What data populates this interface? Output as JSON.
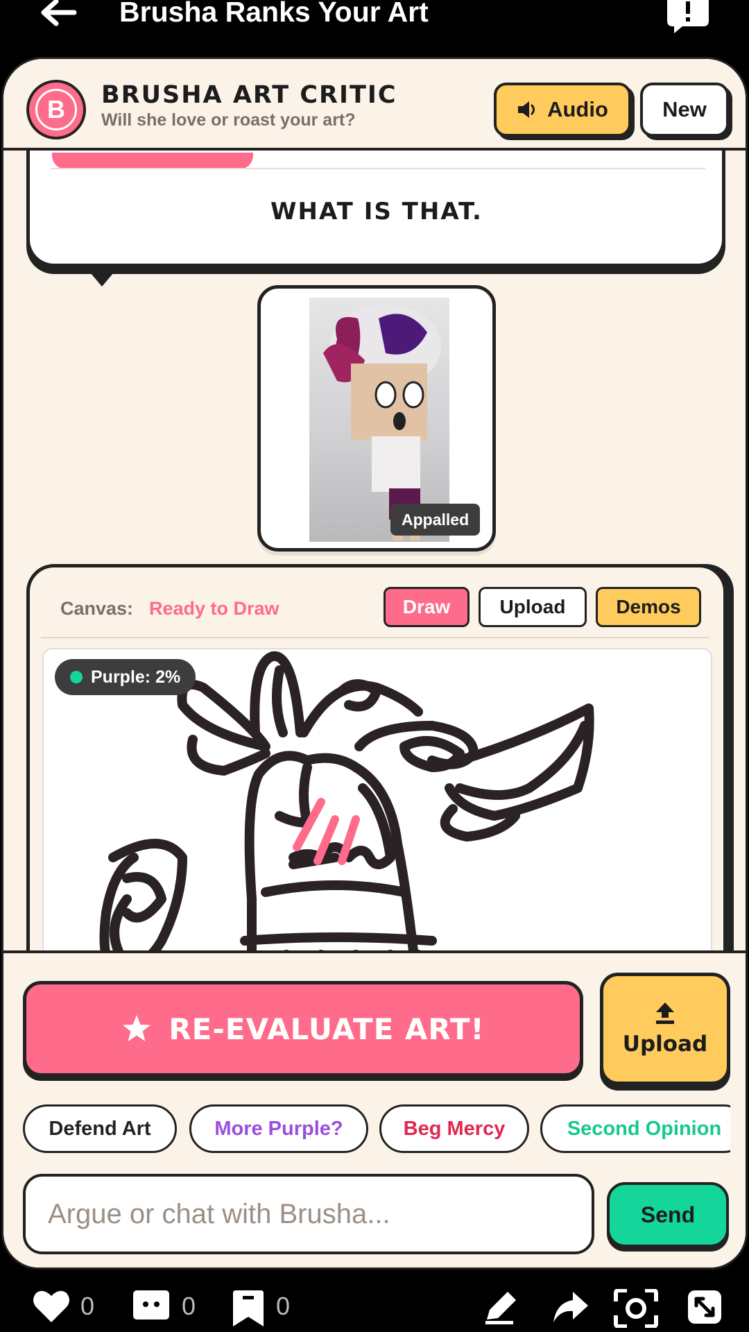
{
  "topbar": {
    "title": "Brusha Ranks Your Art"
  },
  "header": {
    "avatar_letter": "B",
    "title": "BRUSHA ART CRITIC",
    "subtitle": "Will she love or roast your art?",
    "audio_label": "Audio",
    "new_label": "New"
  },
  "bubble": {
    "text": "WHAT IS THAT."
  },
  "preview": {
    "reaction_badge": "Appalled"
  },
  "canvas": {
    "label": "Canvas:",
    "status": "Ready to Draw",
    "tabs": [
      "Draw",
      "Upload",
      "Demos"
    ],
    "purple_badge": "Purple: 2%"
  },
  "controls": {
    "reevaluate_label": "RE-EVALUATE ART!",
    "upload_label": "Upload",
    "chips": [
      "Defend Art",
      "More Purple?",
      "Beg Mercy",
      "Second Opinion"
    ],
    "chat_placeholder": "Argue or chat with Brusha...",
    "send_label": "Send"
  },
  "navbar": {
    "like_count": "0",
    "comment_count": "0",
    "bookmark_count": "0"
  },
  "colors": {
    "accent_pink": "#ff6b8a",
    "accent_yellow": "#ffcb5c",
    "accent_green": "#14d69a",
    "background": "#fbf3e8"
  }
}
